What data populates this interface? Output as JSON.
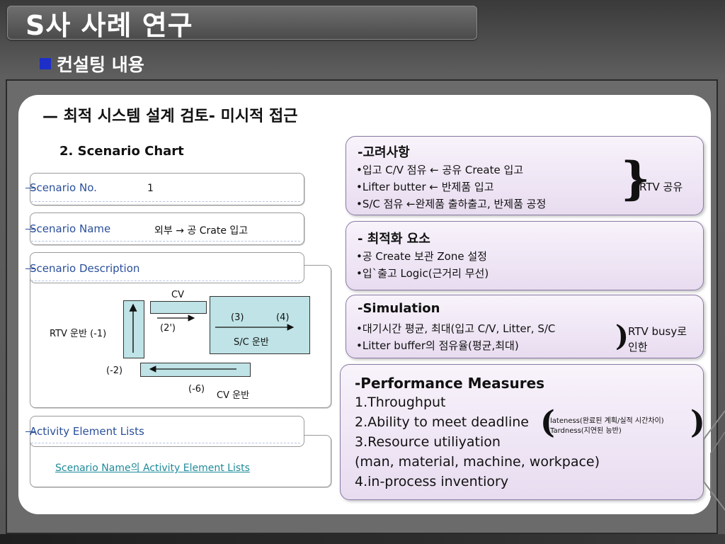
{
  "header": {
    "title": "S사 사례 연구",
    "subtitle": "컨설팅 내용"
  },
  "section": {
    "heading": "— 최적 시스템 설계 검토- 미시적 접근",
    "chart_label": "2. Scenario Chart"
  },
  "scenario_chart": {
    "no_label": "Scenario No.",
    "no_value": "1",
    "name_label": "Scenario Name",
    "name_value": "외부 → 공 Crate 입고",
    "description_label": "Scenario Description",
    "diagram": {
      "cv": "CV",
      "rtv": "RTV 운반 (-1)",
      "step2p": "(2')",
      "step3": "(3)",
      "step4": "(4)",
      "sc": "S/C 운반",
      "step_m2": "(-2)",
      "step_m6": "(-6)",
      "cv_move": "CV 운반"
    },
    "activity_label": "Activity Element Lists",
    "activity_link": "Scenario Name의 Activity Element Lists"
  },
  "considerations": {
    "title": "-고려사항",
    "items": [
      "•입고 C/V 점유 ← 공유 Create 입고",
      "•Lifter butter ← 반제품 입고",
      "•S/C 점유 ←완제품 출하출고, 반제품 공정"
    ],
    "note": "RTV 공유"
  },
  "optimization": {
    "title": "- 최적화 요소",
    "items": [
      "•공 Create 보관 Zone 설정",
      "•입`출고 Logic(근거리 무선)"
    ]
  },
  "simulation": {
    "title": "-Simulation",
    "items": [
      "•대기시간 평균, 최대(입고 C/V, Litter, S/C",
      "•Litter buffer의 점유율(평균,최대)"
    ],
    "note_line1": "RTV busy로",
    "note_line2": "인한"
  },
  "performance": {
    "title": "-Performance Measures",
    "items": [
      "1.Throughput",
      "2.Ability to meet deadline",
      "3.Resource utiliyation",
      "(man, material, machine, workpace)",
      "4.in-process inventiory"
    ],
    "note_line1": "lateness(완료된 계획/실적 시간차이)",
    "note_line2": "Tardness(지연된 능반)"
  },
  "colors": {
    "accent_square": "#1d2fc8",
    "box_fill": "#e8dcf0",
    "diagram_fill": "#bfe3e6",
    "scenario_text": "#2a4f9a"
  }
}
